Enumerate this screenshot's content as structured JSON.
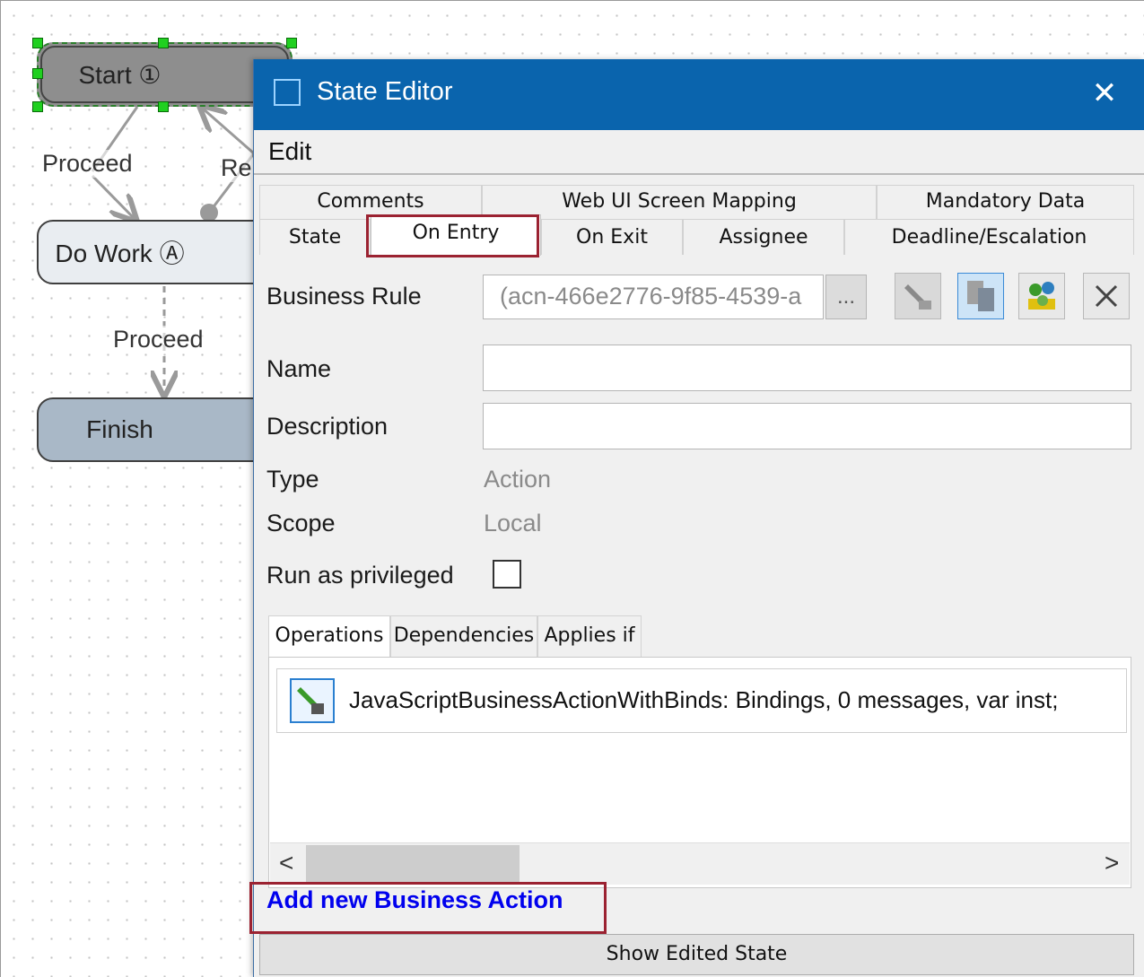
{
  "workflow": {
    "nodes": {
      "start": "Start ①",
      "do_work": "Do Work Ⓐ",
      "finish": "Finish"
    },
    "edges": {
      "proceed_1": "Proceed",
      "return_partial": "Re",
      "proceed_2": "Proceed"
    }
  },
  "dialog": {
    "title": "State Editor",
    "close_icon": "✕",
    "menu": {
      "edit": "Edit"
    },
    "tabs_row1": [
      "Comments",
      "Web UI Screen Mapping",
      "Mandatory Data"
    ],
    "tabs_row2": [
      "State",
      "On Entry",
      "On Exit",
      "Assignee",
      "Deadline/Escalation"
    ],
    "active_tab": "On Entry",
    "form": {
      "business_rule_label": "Business Rule",
      "business_rule_value": "(acn-466e2776-9f85-4539-a",
      "ellipsis": "...",
      "name_label": "Name",
      "name_value": "",
      "description_label": "Description",
      "description_value": "",
      "type_label": "Type",
      "type_value": "Action",
      "scope_label": "Scope",
      "scope_value": "Local",
      "run_as_privileged_label": "Run as privileged",
      "run_as_privileged_checked": false
    },
    "subtabs": [
      "Operations",
      "Dependencies",
      "Applies if"
    ],
    "operations": [
      "JavaScriptBusinessActionWithBinds: Bindings, 0 messages, var inst;"
    ],
    "scroll": {
      "left": "<",
      "right": ">"
    },
    "add_link": "Add new Business Action",
    "show_button": "Show Edited State",
    "colors": {
      "titlebar": "#0a64ad",
      "highlight": "#9b2231",
      "link": "#0000ee"
    }
  }
}
